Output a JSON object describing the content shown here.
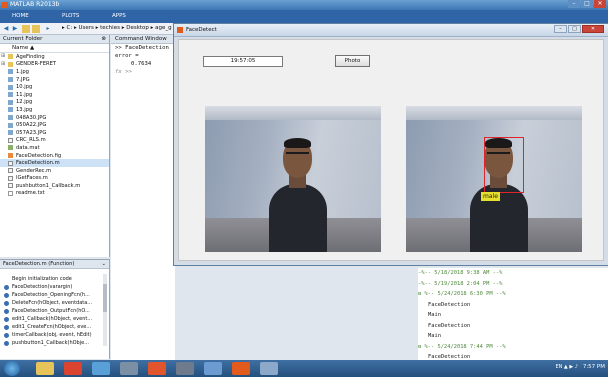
{
  "app": {
    "title": "MATLAB R2013b",
    "window_buttons": [
      "–",
      "□",
      "✕"
    ]
  },
  "ribbon": {
    "tabs": [
      "HOME",
      "PLOTS",
      "APPS"
    ]
  },
  "path": {
    "crumbs": "▸ C: ▸ Users ▸ techies ▸ Desktop ▸ age_g"
  },
  "current_folder": {
    "title": "Current Folder",
    "column": "Name ▲",
    "items": [
      {
        "name": "AgeFinding",
        "type": "folder"
      },
      {
        "name": "GENDER-FERET",
        "type": "folder"
      },
      {
        "name": "1.jpg",
        "type": "img"
      },
      {
        "name": "7.JPG",
        "type": "img"
      },
      {
        "name": "10.jpg",
        "type": "img"
      },
      {
        "name": "11.jpg",
        "type": "img"
      },
      {
        "name": "12.jpg",
        "type": "img"
      },
      {
        "name": "13.jpg",
        "type": "img"
      },
      {
        "name": "048A30.JPG",
        "type": "img"
      },
      {
        "name": "050A22.JPG",
        "type": "img"
      },
      {
        "name": "057A23.JPG",
        "type": "img"
      },
      {
        "name": "CRC_RLS.m",
        "type": "mfile"
      },
      {
        "name": "data.mat",
        "type": "mat"
      },
      {
        "name": "FaceDetection.fig",
        "type": "fig"
      },
      {
        "name": "FaceDetection.m",
        "type": "mfile"
      },
      {
        "name": "GenderRec.m",
        "type": "mfile"
      },
      {
        "name": "lGetFaces.m",
        "type": "mfile"
      },
      {
        "name": "pushbutton1_Callback.m",
        "type": "mfile"
      },
      {
        "name": "readme.txt",
        "type": "txt"
      }
    ],
    "selected_index": 14
  },
  "details": {
    "title": "FaceDetection.m (Function)",
    "summary": "Begin initialization code",
    "functions": [
      "FaceDetection(varargin)",
      "FaceDetection_OpeningFcn(h...",
      "DeleteFcn(hObject, eventdata...",
      "FaceDetection_OutputFcn(hO...",
      "edit1_Callback(hObject, event...",
      "edit1_CreateFcn(hObject, eve...",
      "timerCallback(obj, event, hEdit)",
      "pushbutton1_Callback(hObje..."
    ]
  },
  "command_window": {
    "title": "Command Window",
    "lines": [
      ">> FaceDetection",
      "error =",
      "0.7634",
      "fx >>"
    ]
  },
  "command_history": [
    {
      "text": "-%-- 5/18/2018 9:38 AM --%",
      "kind": "header"
    },
    {
      "text": "-%-- 5/19/2018 2:04 PM --%",
      "kind": "header"
    },
    {
      "text": "⊟ %-- 5/24/2018 6:30 PM --%",
      "kind": "header"
    },
    {
      "text": "FaceDetection",
      "kind": "cmd"
    },
    {
      "text": "Main",
      "kind": "cmd"
    },
    {
      "text": "FaceDetection",
      "kind": "cmd"
    },
    {
      "text": "Main",
      "kind": "cmd"
    },
    {
      "text": "⊟ %-- 5/24/2018 7:44 PM --%",
      "kind": "header"
    },
    {
      "text": "FaceDetection",
      "kind": "cmd"
    }
  ],
  "figure": {
    "title": "FaceDetect",
    "time_value": "19:57:05",
    "photo_button": "Photo",
    "gender_label": "male"
  },
  "taskbar": {
    "tray_text": "EN ▲ ▶ ♪",
    "clock": "7:57 PM"
  },
  "colors": {
    "ribbon": "#2f64a6",
    "face_box": "#e0242c",
    "label_bg": "#e6df2b"
  }
}
